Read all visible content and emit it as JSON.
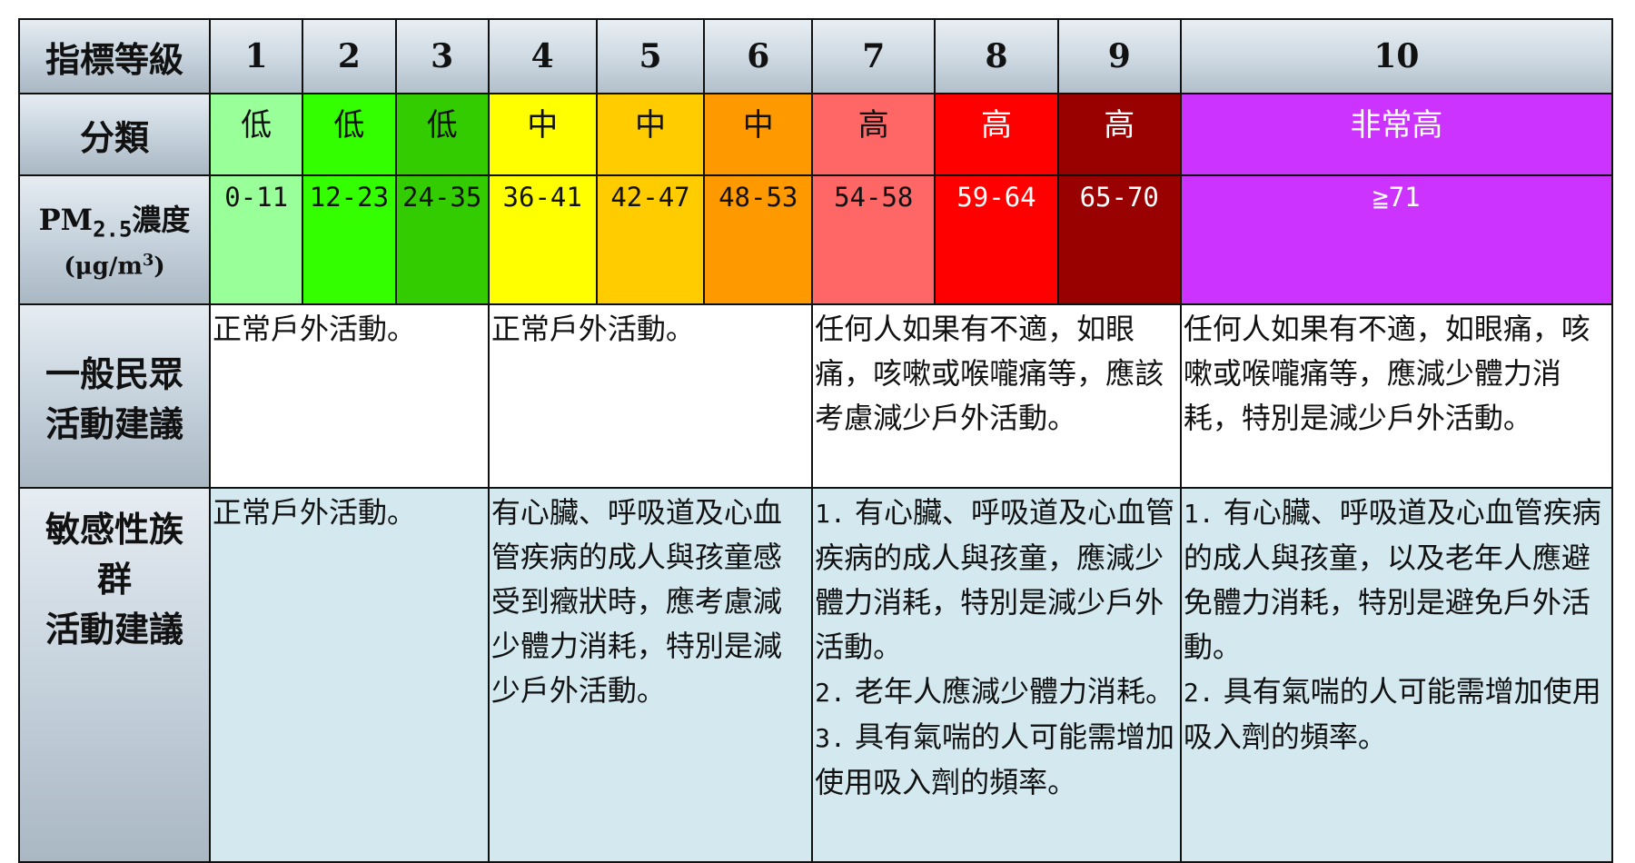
{
  "headers": {
    "level": "指標等級",
    "category": "分類",
    "pm_prefix": "PM",
    "pm_sub": "2.5",
    "pm_suffix": "濃度",
    "unit_prefix": "(μg/m",
    "unit_sup": "3",
    "unit_suffix": ")",
    "general_line1": "一般民眾",
    "general_line2": "活動建議",
    "sensitive_line1": "敏感性族",
    "sensitive_line2": "群",
    "sensitive_line3": "活動建議"
  },
  "levels": [
    {
      "num": "1",
      "category": "低",
      "range": "0-11",
      "color": "#99ff99"
    },
    {
      "num": "2",
      "category": "低",
      "range": "12-23",
      "color": "#33ff00"
    },
    {
      "num": "3",
      "category": "低",
      "range": "24-35",
      "color": "#33cc00"
    },
    {
      "num": "4",
      "category": "中",
      "range": "36-41",
      "color": "#ffff00"
    },
    {
      "num": "5",
      "category": "中",
      "range": "42-47",
      "color": "#ffcc00"
    },
    {
      "num": "6",
      "category": "中",
      "range": "48-53",
      "color": "#ff9900"
    },
    {
      "num": "7",
      "category": "高",
      "range": "54-58",
      "color": "#ff6666"
    },
    {
      "num": "8",
      "category": "高",
      "range": "59-64",
      "color": "#ff0000"
    },
    {
      "num": "9",
      "category": "高",
      "range": "65-70",
      "color": "#990000"
    },
    {
      "num": "10",
      "category": "非常高",
      "range": "≧71",
      "color": "#cc33ff"
    }
  ],
  "general_advice": {
    "low": "正常戶外活動。",
    "medium": "正常戶外活動。",
    "high": "任何人如果有不適，如眼痛，咳嗽或喉嚨痛等，應該考慮減少戶外活動。",
    "very_high": "任何人如果有不適，如眼痛，咳嗽或喉嚨痛等，應減少體力消耗，特別是減少戶外活動。"
  },
  "sensitive_advice": {
    "low": "正常戶外活動。",
    "medium": "有心臟、呼吸道及心血管疾病的成人與孩童感受到癥狀時，應考慮減少體力消耗，特別是減少戶外活動。",
    "high": [
      {
        "num": "1.",
        "text": "有心臟、呼吸道及心血管疾病的成人與孩童，應減少體力消耗，特別是減少戶外活動。"
      },
      {
        "num": "2.",
        "text": "老年人應減少體力消耗。"
      },
      {
        "num": "3.",
        "text": "具有氣喘的人可能需增加使用吸入劑的頻率。"
      }
    ],
    "very_high": [
      {
        "num": "1.",
        "text": "有心臟、呼吸道及心血管疾病的成人與孩童，以及老年人應避免體力消耗，特別是避免戶外活動。"
      },
      {
        "num": "2.",
        "text": "具有氣喘的人可能需增加使用吸入劑的頻率。"
      }
    ]
  }
}
